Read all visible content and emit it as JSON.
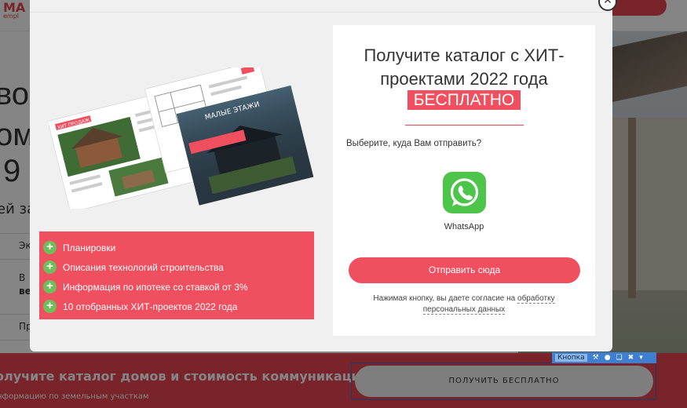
{
  "background": {
    "logo": "МА",
    "logo_sub": "empl",
    "heading_fragments": [
      "во",
      "ом",
      "9"
    ],
    "small_text": "ей за",
    "fields": [
      "Эк",
      "В",
      "ве",
      "Пр"
    ],
    "bottom_title": "олучите каталог домов и стоимость коммуникаций",
    "bottom_subtitle": "нформацию по земельным участкам",
    "bottom_button": "ПОЛУЧИТЬ БЕСПЛАТНО",
    "editor_label": "Кнопка"
  },
  "modal": {
    "title": "Получите каталог с ХИТ-проектами 2022 года",
    "free_badge": "БЕСПЛАТНО",
    "choose_prompt": "Выберите, куда Вам отправить?",
    "channel_label": "WhatsApp",
    "send_button": "Отправить сюда",
    "consent_text": "Нажимая кнопку, вы даете согласие на ",
    "consent_link": "обработку персональных данных",
    "features": [
      "Планировки",
      "Описания технологий строительства",
      "Информация по ипотеке со ставкой от 3%",
      "10 отобранных ХИТ-проектов 2022 года"
    ],
    "catalog_cover_title": "МАЛЫЕ ЭТАЖИ",
    "catalog_page_tag": "ХИТ ПРОДАЖ"
  },
  "colors": {
    "accent": "#ef4f5e",
    "whatsapp": "#4cc54a",
    "plus": "#6dbf5a"
  },
  "icons": {
    "close": "close-icon",
    "whatsapp": "whatsapp-icon",
    "plus": "plus-icon"
  }
}
